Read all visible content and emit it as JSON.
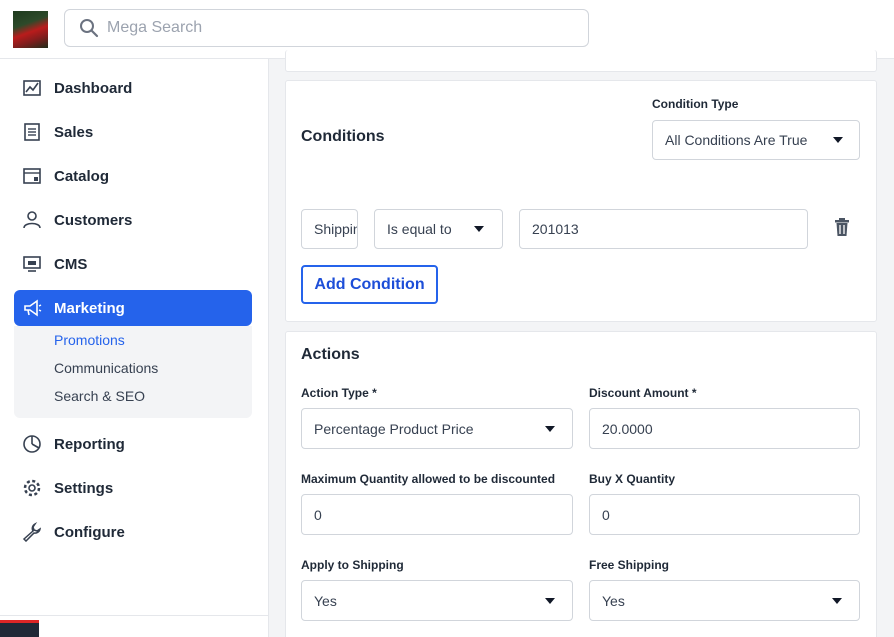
{
  "header": {
    "search_placeholder": "Mega Search",
    "avatar_icon": "user-avatar-photo",
    "search_icon": "search-icon"
  },
  "sidebar": {
    "items": [
      {
        "label": "Dashboard",
        "icon": "dashboard-chart-icon"
      },
      {
        "label": "Sales",
        "icon": "sales-receipt-icon"
      },
      {
        "label": "Catalog",
        "icon": "catalog-icon"
      },
      {
        "label": "Customers",
        "icon": "customers-user-icon"
      },
      {
        "label": "CMS",
        "icon": "cms-monitor-icon"
      },
      {
        "label": "Marketing",
        "icon": "megaphone-icon",
        "active": true
      },
      {
        "label": "Reporting",
        "icon": "pie-chart-icon"
      },
      {
        "label": "Settings",
        "icon": "gear-icon"
      },
      {
        "label": "Configure",
        "icon": "wrench-icon"
      }
    ],
    "marketing_submenu": [
      {
        "label": "Promotions",
        "active": true
      },
      {
        "label": "Communications"
      },
      {
        "label": "Search & SEO"
      }
    ]
  },
  "conditions": {
    "title": "Conditions",
    "condition_type_label": "Condition Type",
    "condition_type_value": "All Conditions Are True",
    "row": {
      "attribute_value": "Shipping",
      "operator_value": "Is equal to",
      "value": "201013"
    },
    "add_button": "Add Condition"
  },
  "actions": {
    "title": "Actions",
    "action_type_label": "Action Type *",
    "action_type_value": "Percentage Product Price",
    "discount_amount_label": "Discount Amount *",
    "discount_amount_value": "20.0000",
    "max_qty_label": "Maximum Quantity allowed to be discounted",
    "max_qty_value": "0",
    "buy_x_label": "Buy X Quantity",
    "buy_x_value": "0",
    "apply_shipping_label": "Apply to Shipping",
    "apply_shipping_value": "Yes",
    "free_shipping_label": "Free Shipping",
    "free_shipping_value": "Yes"
  },
  "colors": {
    "accent": "#2563eb",
    "text": "#1f2937",
    "border": "#d1d5db"
  }
}
